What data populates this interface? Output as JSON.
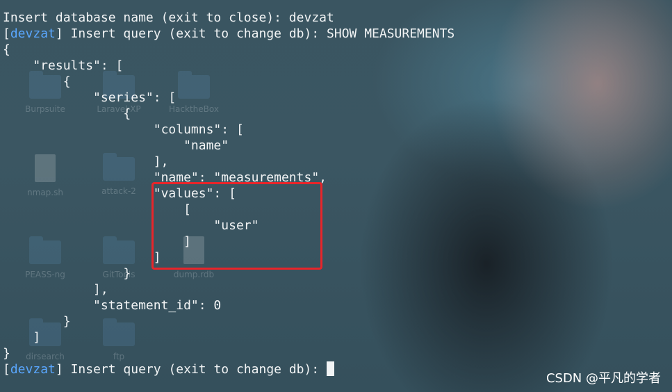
{
  "desktop": {
    "icons": [
      {
        "label": "Burpsuite",
        "kind": "folder"
      },
      {
        "label": "Laravel-XP",
        "kind": "folder"
      },
      {
        "label": "HacktheBox",
        "kind": "folder"
      },
      {
        "label": "nmap.sh",
        "kind": "file"
      },
      {
        "label": "attack-2",
        "kind": "folder"
      },
      {
        "label": "PEASS-ng",
        "kind": "folder"
      },
      {
        "label": "GitTools",
        "kind": "folder"
      },
      {
        "label": "dump.rdb",
        "kind": "file"
      },
      {
        "label": "dirsearch",
        "kind": "folder"
      },
      {
        "label": "ftp",
        "kind": "folder"
      }
    ]
  },
  "terminal": {
    "lines": [
      "Insert database name (exit to close): devzat",
      "Insert query (exit to change db): SHOW MEASUREMENTS",
      "{",
      "    \"results\": [",
      "        {",
      "            \"series\": [",
      "                {",
      "                    \"columns\": [",
      "                        \"name\"",
      "                    ],",
      "                    \"name\": \"measurements\",",
      "                    \"values\": [",
      "                        [",
      "                            \"user\"",
      "                        ]",
      "                    ]",
      "                }",
      "            ],",
      "            \"statement_id\": 0",
      "        }",
      "    ]",
      "}",
      "Insert query (exit to change db): "
    ],
    "db_name": "devzat",
    "bracket_open": "[",
    "bracket_close": "] ",
    "prompt_color": "#5aa7ff"
  },
  "highlight": {
    "color": "#e8252a"
  },
  "watermark": "CSDN @平凡的学者"
}
